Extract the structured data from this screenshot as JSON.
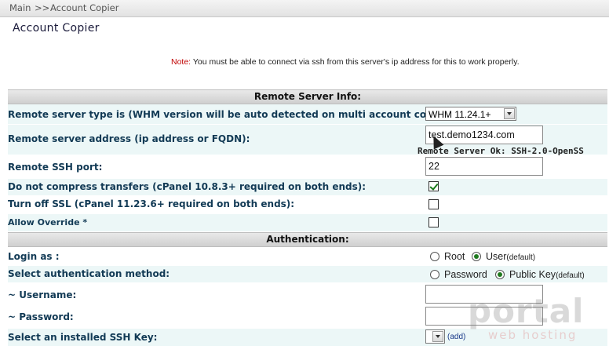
{
  "breadcrumb": {
    "root": "Main",
    "separator": ">>",
    "current": "Account Copier"
  },
  "page": {
    "title": "Account Copier",
    "note_label": "Note:",
    "note_text": "You must be able to connect via ssh from this server's ip address for this to work properly."
  },
  "remote_server": {
    "section_title": "Remote Server Info:",
    "type_label": "Remote server type is (WHM version will be auto detected on multi account copies):",
    "type_value": "WHM 11.24.1+",
    "address_label": "Remote server address (ip address or FQDN):",
    "address_value": "test.demo1234.com",
    "address_status": "Remote Server Ok: SSH-2.0-OpenSS",
    "port_label": "Remote SSH port:",
    "port_value": "22",
    "compress_label": "Do not compress transfers (cPanel 10.8.3+ required on both ends):",
    "compress_checked": true,
    "ssl_label": "Turn off SSL (cPanel 11.23.6+ required on both ends):",
    "ssl_checked": false,
    "override_label": "Allow Override *",
    "override_checked": false
  },
  "authentication": {
    "section_title": "Authentication:",
    "login_label": "Login as :",
    "login_root": "Root",
    "login_user": "User",
    "login_user_default": "(default)",
    "method_label": "Select authentication method:",
    "method_password": "Password",
    "method_pubkey": "Public Key",
    "method_pubkey_default": "(default)",
    "username_label": "~ Username:",
    "username_value": "",
    "password_label": "~ Password:",
    "password_value": "",
    "sshkey_label": "Select an installed SSH Key:",
    "sshkey_value": "",
    "sshkey_add": "(add)"
  },
  "watermark": {
    "main": "portal",
    "sub": "web hosting"
  },
  "colors": {
    "note_label": "#c00000",
    "row_alt": "#ecf7f7",
    "label": "#123a55",
    "radio_on": "#1f7a1f"
  }
}
